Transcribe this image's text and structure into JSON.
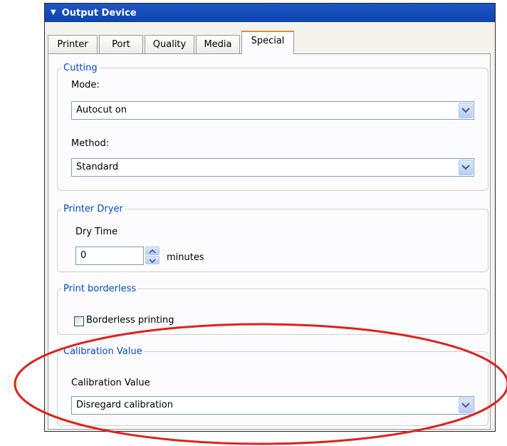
{
  "panel": {
    "title": "Output Device"
  },
  "tabs": [
    {
      "label": "Printer"
    },
    {
      "label": "Port"
    },
    {
      "label": "Quality"
    },
    {
      "label": "Media"
    },
    {
      "label": "Special",
      "active": true
    }
  ],
  "cutting": {
    "group_title": "Cutting",
    "mode_label": "Mode:",
    "mode_value": "Autocut on",
    "method_label": "Method:",
    "method_value": "Standard"
  },
  "dryer": {
    "group_title": "Printer Dryer",
    "drytime_label": "Dry Time",
    "drytime_value": "0",
    "unit": "minutes"
  },
  "borderless": {
    "group_title": "Print borderless",
    "checkbox_label": "Borderless printing",
    "checked": false
  },
  "calibration": {
    "group_title": "Calibration Value",
    "label": "Calibration Value",
    "value": "Disregard calibration"
  },
  "colors": {
    "title_bar": "#0d43ad",
    "group_title": "#0046d5",
    "highlight_ellipse": "#e0201c"
  },
  "icons": {
    "title_toggle": "triangle-down-icon",
    "combo_arrow": "chevron-down-icon",
    "spin": "spin-up-down-icon"
  }
}
